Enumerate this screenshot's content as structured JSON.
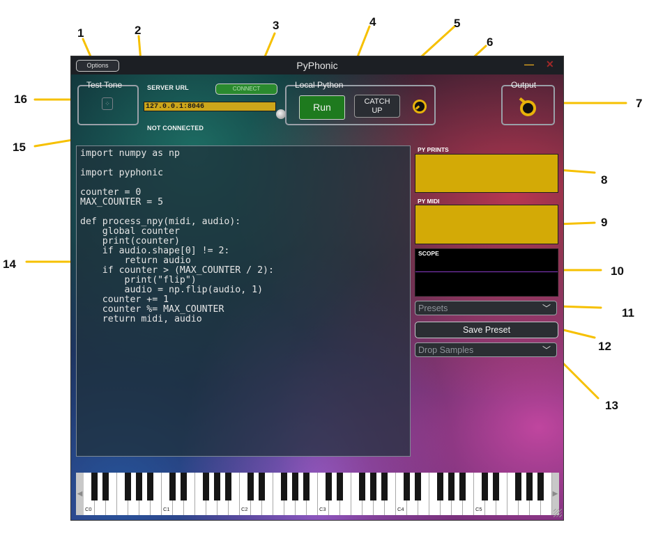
{
  "annotations": [
    "1",
    "2",
    "3",
    "4",
    "5",
    "6",
    "7",
    "8",
    "9",
    "10",
    "11",
    "12",
    "13",
    "14",
    "15",
    "16"
  ],
  "window": {
    "title": "PyPhonic",
    "options_label": "Options",
    "minimize_glyph": "—",
    "close_glyph": "✕"
  },
  "test_tone": {
    "label": "Test Tone",
    "icon": "dice-icon"
  },
  "server": {
    "url_label": "SERVER URL",
    "url_value": "127.0.0.1:8046",
    "connect_label": "CONNECT",
    "status": "NOT CONNECTED"
  },
  "local_python": {
    "label": "Local Python",
    "run_label": "Run",
    "catchup_line1": "CATCH",
    "catchup_line2": "UP"
  },
  "output": {
    "label": "Output"
  },
  "code": "import numpy as np\n\nimport pyphonic\n\ncounter = 0\nMAX_COUNTER = 5\n\ndef process_npy(midi, audio):\n    global counter\n    print(counter)\n    if audio.shape[0] != 2:\n        return audio\n    if counter > (MAX_COUNTER / 2):\n        print(\"flip\")\n        audio = np.flip(audio, 1)\n    counter += 1\n    counter %= MAX_COUNTER\n    return midi, audio",
  "panels": {
    "prints_label": "PY PRINTS",
    "midi_label": "PY MIDI",
    "scope_label": "SCOPE"
  },
  "presets": {
    "placeholder": "Presets",
    "save_label": "Save Preset"
  },
  "samples": {
    "placeholder": "Drop Samples"
  },
  "keyboard": {
    "octave_labels": [
      "C0",
      "C1",
      "C2",
      "C3",
      "C4",
      "C5"
    ],
    "scroll_left": "◀",
    "scroll_right": "▶"
  },
  "colors": {
    "accent_yellow": "#d3aa06",
    "run_green": "#1e7a1e",
    "callout_yellow": "#f6c000",
    "scope_line": "#8b3cc9"
  }
}
